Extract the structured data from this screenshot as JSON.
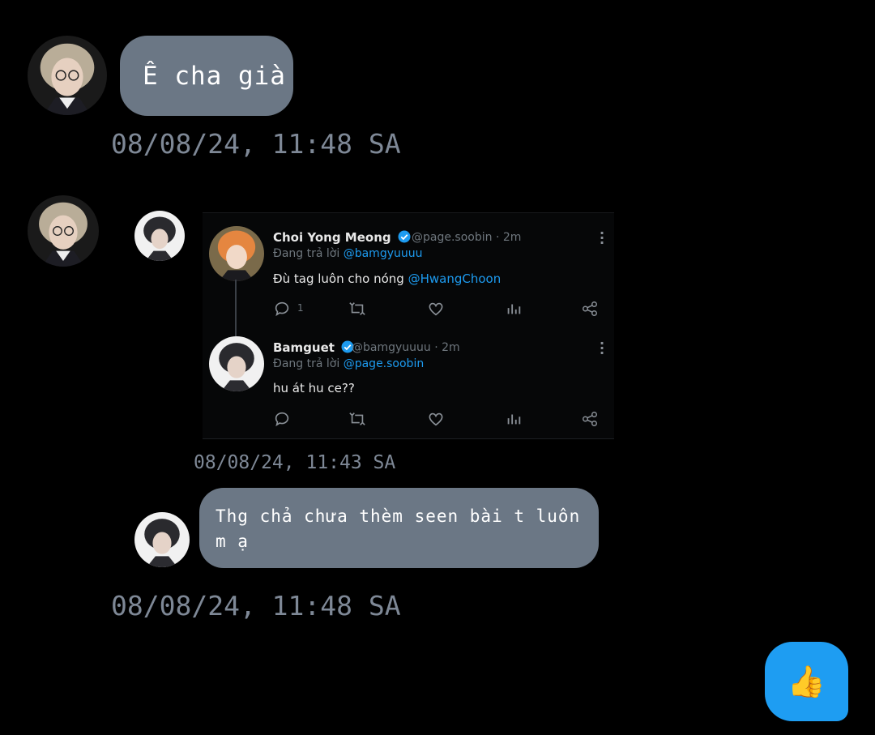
{
  "messages": [
    {
      "sender": "friend",
      "text": "Ê cha già",
      "time": "08/08/24, 11:48 SA"
    },
    {
      "sender": "friend",
      "type": "image",
      "time": "08/08/24, 11:43 SA"
    },
    {
      "sender": "me",
      "text": "Thg chả chưa thèm seen bài t luôn m ạ",
      "time": "08/08/24, 11:48 SA"
    }
  ],
  "tweet_thread": {
    "tweets": [
      {
        "name": "Choi Yong Meong",
        "handle": "@page.soobin",
        "age": "2m",
        "reply_prefix": "Đang trả lời",
        "reply_to": "@bamgyuuuu",
        "body_text": "Đù tag luôn cho nóng",
        "body_mention": "@HwangChoon",
        "reply_count": "1"
      },
      {
        "name": "Bamguet",
        "handle": "@bamgyuuuu",
        "age": "2m",
        "reply_prefix": "Đang trả lời",
        "reply_to": "@page.soobin",
        "body_text": "hu át hu ce??",
        "body_mention": ""
      }
    ]
  },
  "reaction": {
    "icon": "thumbs-up",
    "emoji": "👍"
  },
  "colors": {
    "background": "#000000",
    "bubble": "#6b7785",
    "timestamp": "#7e8896",
    "accent": "#1e9df2",
    "mention": "#1d9bf0"
  }
}
